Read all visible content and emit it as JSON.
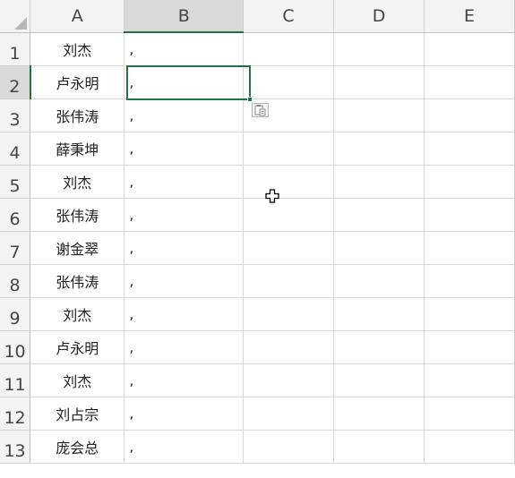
{
  "columns": [
    "A",
    "B",
    "C",
    "D",
    "E"
  ],
  "rows": [
    {
      "num": "1",
      "a": "刘杰",
      "b": ","
    },
    {
      "num": "2",
      "a": "卢永明",
      "b": ","
    },
    {
      "num": "3",
      "a": "张伟涛",
      "b": ","
    },
    {
      "num": "4",
      "a": "薛秉坤",
      "b": ","
    },
    {
      "num": "5",
      "a": "刘杰",
      "b": ","
    },
    {
      "num": "6",
      "a": "张伟涛",
      "b": ","
    },
    {
      "num": "7",
      "a": "谢金翠",
      "b": ","
    },
    {
      "num": "8",
      "a": "张伟涛",
      "b": ","
    },
    {
      "num": "9",
      "a": "刘杰",
      "b": ","
    },
    {
      "num": "10",
      "a": "卢永明",
      "b": ","
    },
    {
      "num": "11",
      "a": "刘杰",
      "b": ","
    },
    {
      "num": "12",
      "a": "刘占宗",
      "b": ","
    },
    {
      "num": "13",
      "a": "庞会总",
      "b": ","
    }
  ],
  "selection": {
    "column": "B",
    "row": "2"
  },
  "colors": {
    "accent": "#217346",
    "header_bg": "#f3f3f3",
    "header_selected_bg": "#d9d9d9",
    "gridline": "#d9d9d9"
  },
  "icons": {
    "select_all": "select-all-triangle-icon",
    "paste_options": "paste-options-icon",
    "cursor": "cell-select-cursor-icon"
  }
}
